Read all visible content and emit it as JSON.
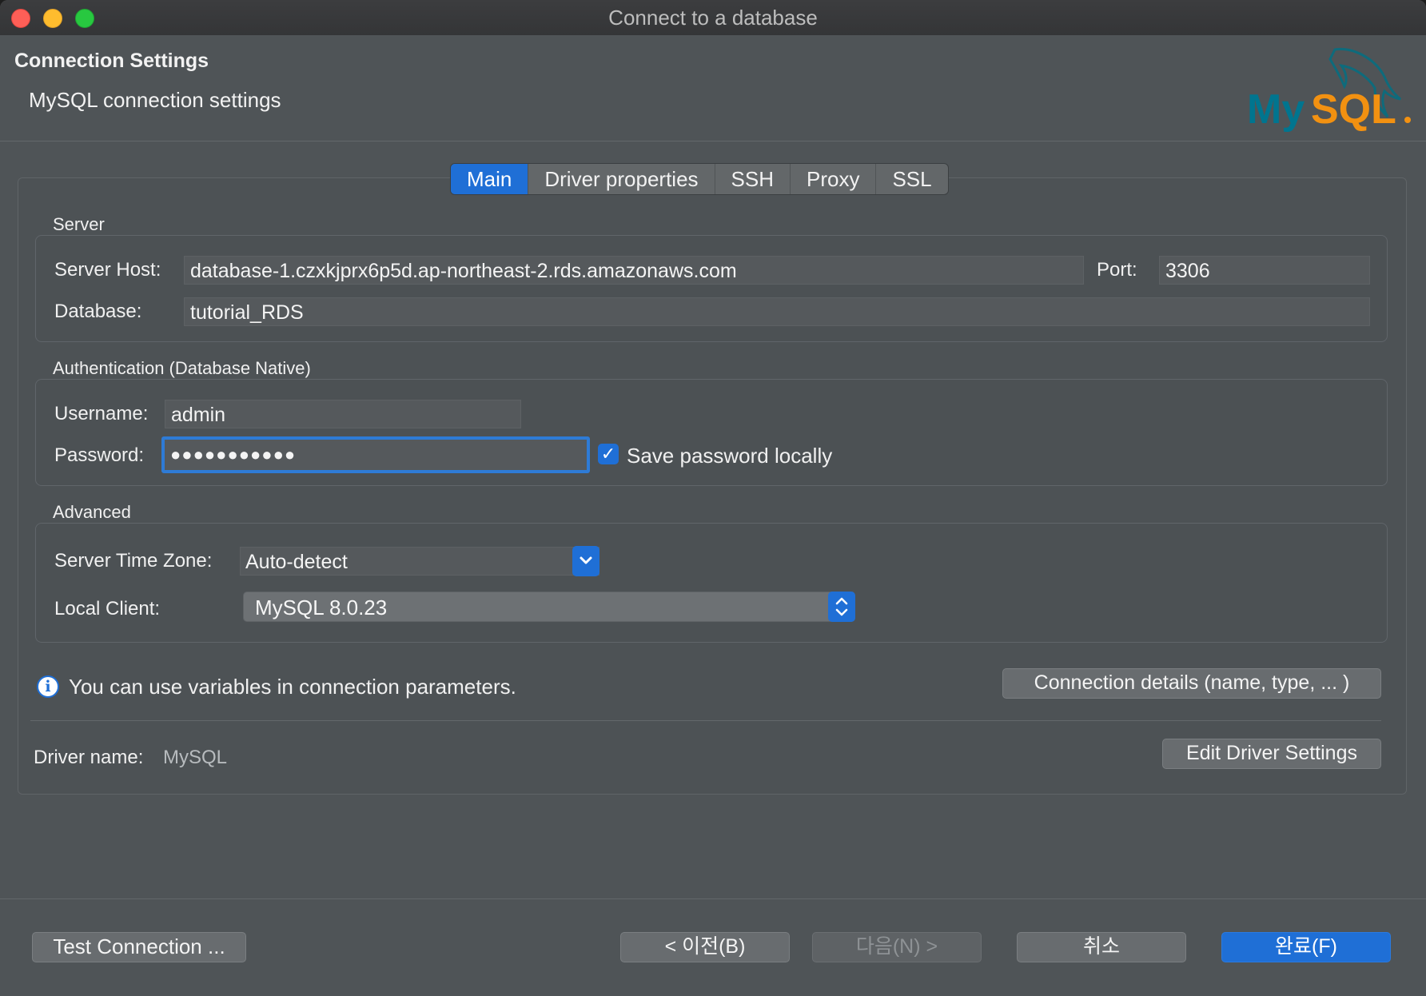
{
  "window": {
    "title": "Connect to a database"
  },
  "header": {
    "title": "Connection Settings",
    "subtitle": "MySQL connection settings",
    "logo_text": "MySQL"
  },
  "tabs": [
    {
      "label": "Main",
      "active": true
    },
    {
      "label": "Driver properties",
      "active": false
    },
    {
      "label": "SSH",
      "active": false
    },
    {
      "label": "Proxy",
      "active": false
    },
    {
      "label": "SSL",
      "active": false
    }
  ],
  "server": {
    "section_label": "Server",
    "host_label": "Server Host:",
    "host_value": "database-1.czxkjprx6p5d.ap-northeast-2.rds.amazonaws.com",
    "port_label": "Port:",
    "port_value": "3306",
    "database_label": "Database:",
    "database_value": "tutorial_RDS"
  },
  "auth": {
    "section_label": "Authentication (Database Native)",
    "username_label": "Username:",
    "username_value": "admin",
    "password_label": "Password:",
    "password_value": "●●●●●●●●●●●",
    "save_password_label": "Save password locally",
    "save_password_checked": true
  },
  "advanced": {
    "section_label": "Advanced",
    "timezone_label": "Server Time Zone:",
    "timezone_value": "Auto-detect",
    "local_client_label": "Local Client:",
    "local_client_value": "MySQL 8.0.23"
  },
  "info": {
    "text": "You can use variables in connection parameters.",
    "details_button": "Connection details (name, type, ... )"
  },
  "driver": {
    "name_label": "Driver name:",
    "name_value": "MySQL",
    "edit_button": "Edit Driver Settings"
  },
  "footer": {
    "test_button": "Test Connection ...",
    "back_button": "< 이전(B)",
    "next_button": "다음(N) >",
    "cancel_button": "취소",
    "finish_button": "완료(F)"
  },
  "colors": {
    "accent": "#1f6fd6",
    "background": "#4f5457",
    "mysql_blue": "#00758f",
    "mysql_orange": "#f29111"
  }
}
